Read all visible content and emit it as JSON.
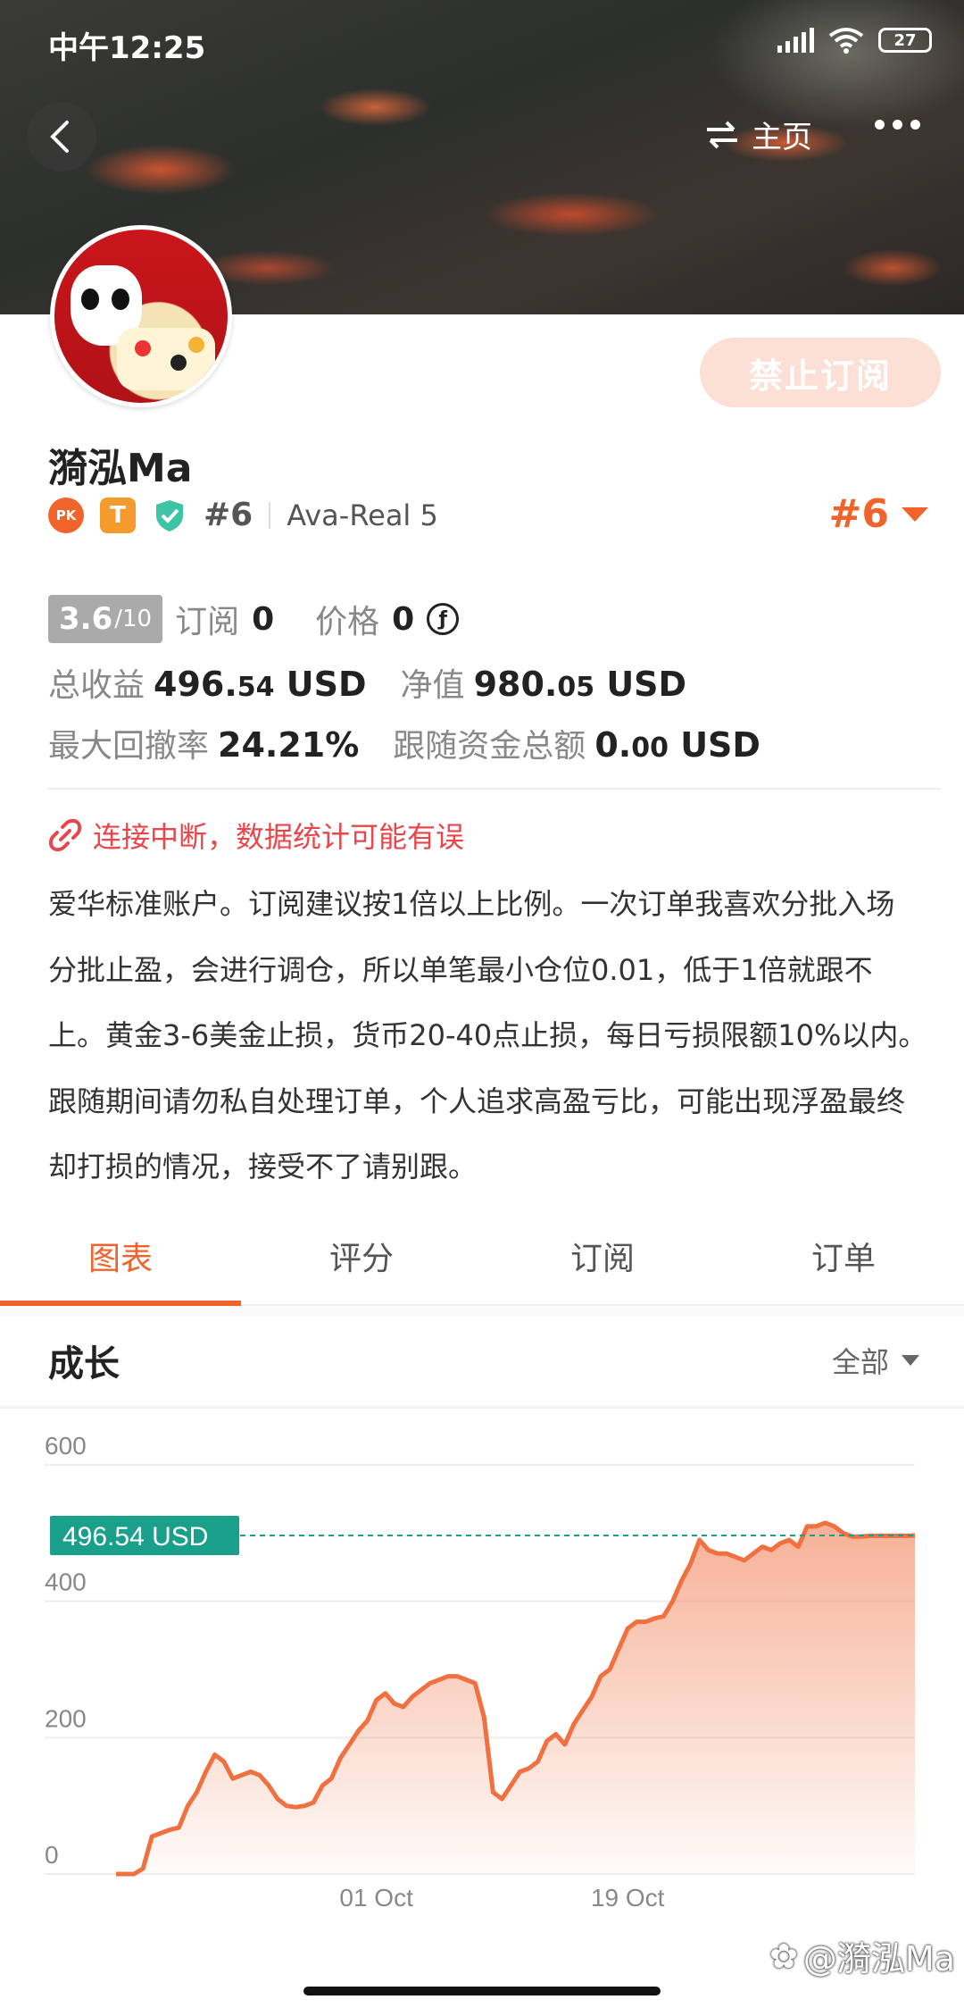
{
  "status_bar": {
    "time": "中午12:25",
    "battery": "27"
  },
  "header": {
    "home_label": "主页"
  },
  "profile": {
    "name": "漪泓Ma",
    "block_button": "禁止订阅",
    "pk_badge": "PK",
    "t_badge": "T",
    "rank": "#6",
    "server": "Ava-Real 5",
    "rank_big": "#6"
  },
  "stats": {
    "score": "3.6",
    "score_den": "/10",
    "subscribe_label": "订阅",
    "subscribe_value": "0",
    "price_label": "价格",
    "price_value": "0",
    "price_coin": "ƒ",
    "total_profit_label": "总收益",
    "total_profit_int": "496.",
    "total_profit_dec": "54",
    "total_profit_unit": "USD",
    "equity_label": "净值",
    "equity_int": "980.",
    "equity_dec": "05",
    "equity_unit": "USD",
    "drawdown_label": "最大回撤率",
    "drawdown_value": "24.21%",
    "follow_label": "跟随资金总额",
    "follow_int": "0.",
    "follow_dec": "00",
    "follow_unit": "USD"
  },
  "warning": "连接中断，数据统计可能有误",
  "description": [
    "爱华标准账户。订阅建议按1倍以上比例。一次订单我喜欢分批入场",
    "分批止盈，会进行调仓，所以单笔最小仓位0.01，低于1倍就跟不",
    "上。黄金3-6美金止损，货币20-40点止损，每日亏损限额10%以内。",
    "跟随期间请勿私自处理订单，个人追求高盈亏比，可能出现浮盈最终",
    "却打损的情况，接受不了请别跟。"
  ],
  "tabs": [
    {
      "label": "图表",
      "active": true
    },
    {
      "label": "评分",
      "active": false
    },
    {
      "label": "订阅",
      "active": false
    },
    {
      "label": "订单",
      "active": false
    }
  ],
  "growth": {
    "title": "成长",
    "range": "全部"
  },
  "chart_data": {
    "type": "area",
    "ylim": [
      0,
      600
    ],
    "yticks": [
      "0",
      "200",
      "400",
      "600"
    ],
    "xticks": [
      {
        "label": "01 Oct",
        "x": 29
      },
      {
        "label": "19 Oct",
        "x": 57
      }
    ],
    "current_label": "496.54 USD",
    "current_value": 496.54,
    "line_color": "#f07040",
    "marker_color": "#1aa08a",
    "x": [
      0,
      1,
      2,
      3,
      4,
      5,
      6,
      7,
      8,
      9,
      10,
      11,
      12,
      13,
      14,
      15,
      16,
      17,
      18,
      19,
      20,
      21,
      22,
      23,
      24,
      25,
      26,
      27,
      28,
      29,
      30,
      31,
      32,
      33,
      34,
      35,
      36,
      37,
      38,
      39,
      40,
      41,
      42,
      43,
      44,
      45,
      46,
      47,
      48,
      49,
      50,
      51,
      52,
      53,
      54,
      55,
      56,
      57,
      58,
      59,
      60,
      61,
      62,
      63,
      64,
      65,
      66,
      67,
      68,
      69,
      70,
      71,
      72,
      73,
      74,
      75,
      76,
      77,
      78,
      79,
      80,
      81,
      82,
      83,
      84,
      85,
      86,
      87,
      88,
      89
    ],
    "values": [
      0,
      0,
      0,
      8,
      55,
      60,
      65,
      68,
      100,
      120,
      150,
      175,
      165,
      140,
      145,
      150,
      145,
      130,
      110,
      100,
      98,
      100,
      105,
      130,
      140,
      170,
      190,
      210,
      225,
      255,
      265,
      250,
      245,
      260,
      270,
      280,
      285,
      290,
      290,
      285,
      280,
      230,
      120,
      110,
      130,
      150,
      155,
      165,
      195,
      205,
      190,
      220,
      240,
      260,
      290,
      300,
      330,
      360,
      370,
      370,
      375,
      378,
      400,
      430,
      455,
      490,
      475,
      470,
      470,
      465,
      460,
      470,
      480,
      475,
      485,
      490,
      480,
      510,
      510,
      515,
      510,
      500,
      495,
      495,
      496,
      496,
      496,
      496,
      496,
      496.54
    ]
  },
  "watermark": "@漪泓Ma"
}
